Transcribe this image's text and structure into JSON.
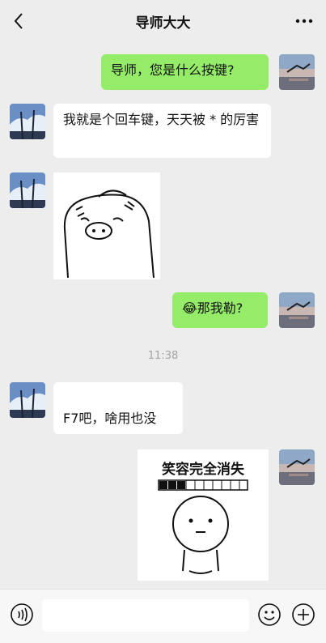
{
  "header": {
    "title": "导师大大"
  },
  "messages": {
    "m1": "导师，您是什么按键?",
    "m2": "我就是个回车键，天天被 * 的厉害",
    "m4_emoji": "😂",
    "m4": "那我勒?",
    "time": "11:38",
    "m5": "F7吧，啥用也没",
    "sticker_caption": "笑容完全消失"
  },
  "input": {
    "placeholder": ""
  },
  "colors": {
    "self_bubble": "#95ec69",
    "other_bubble": "#ffffff",
    "background": "#ededed"
  },
  "icons": [
    "back-icon",
    "more-icon",
    "voice-icon",
    "emoji-icon",
    "plus-icon"
  ]
}
